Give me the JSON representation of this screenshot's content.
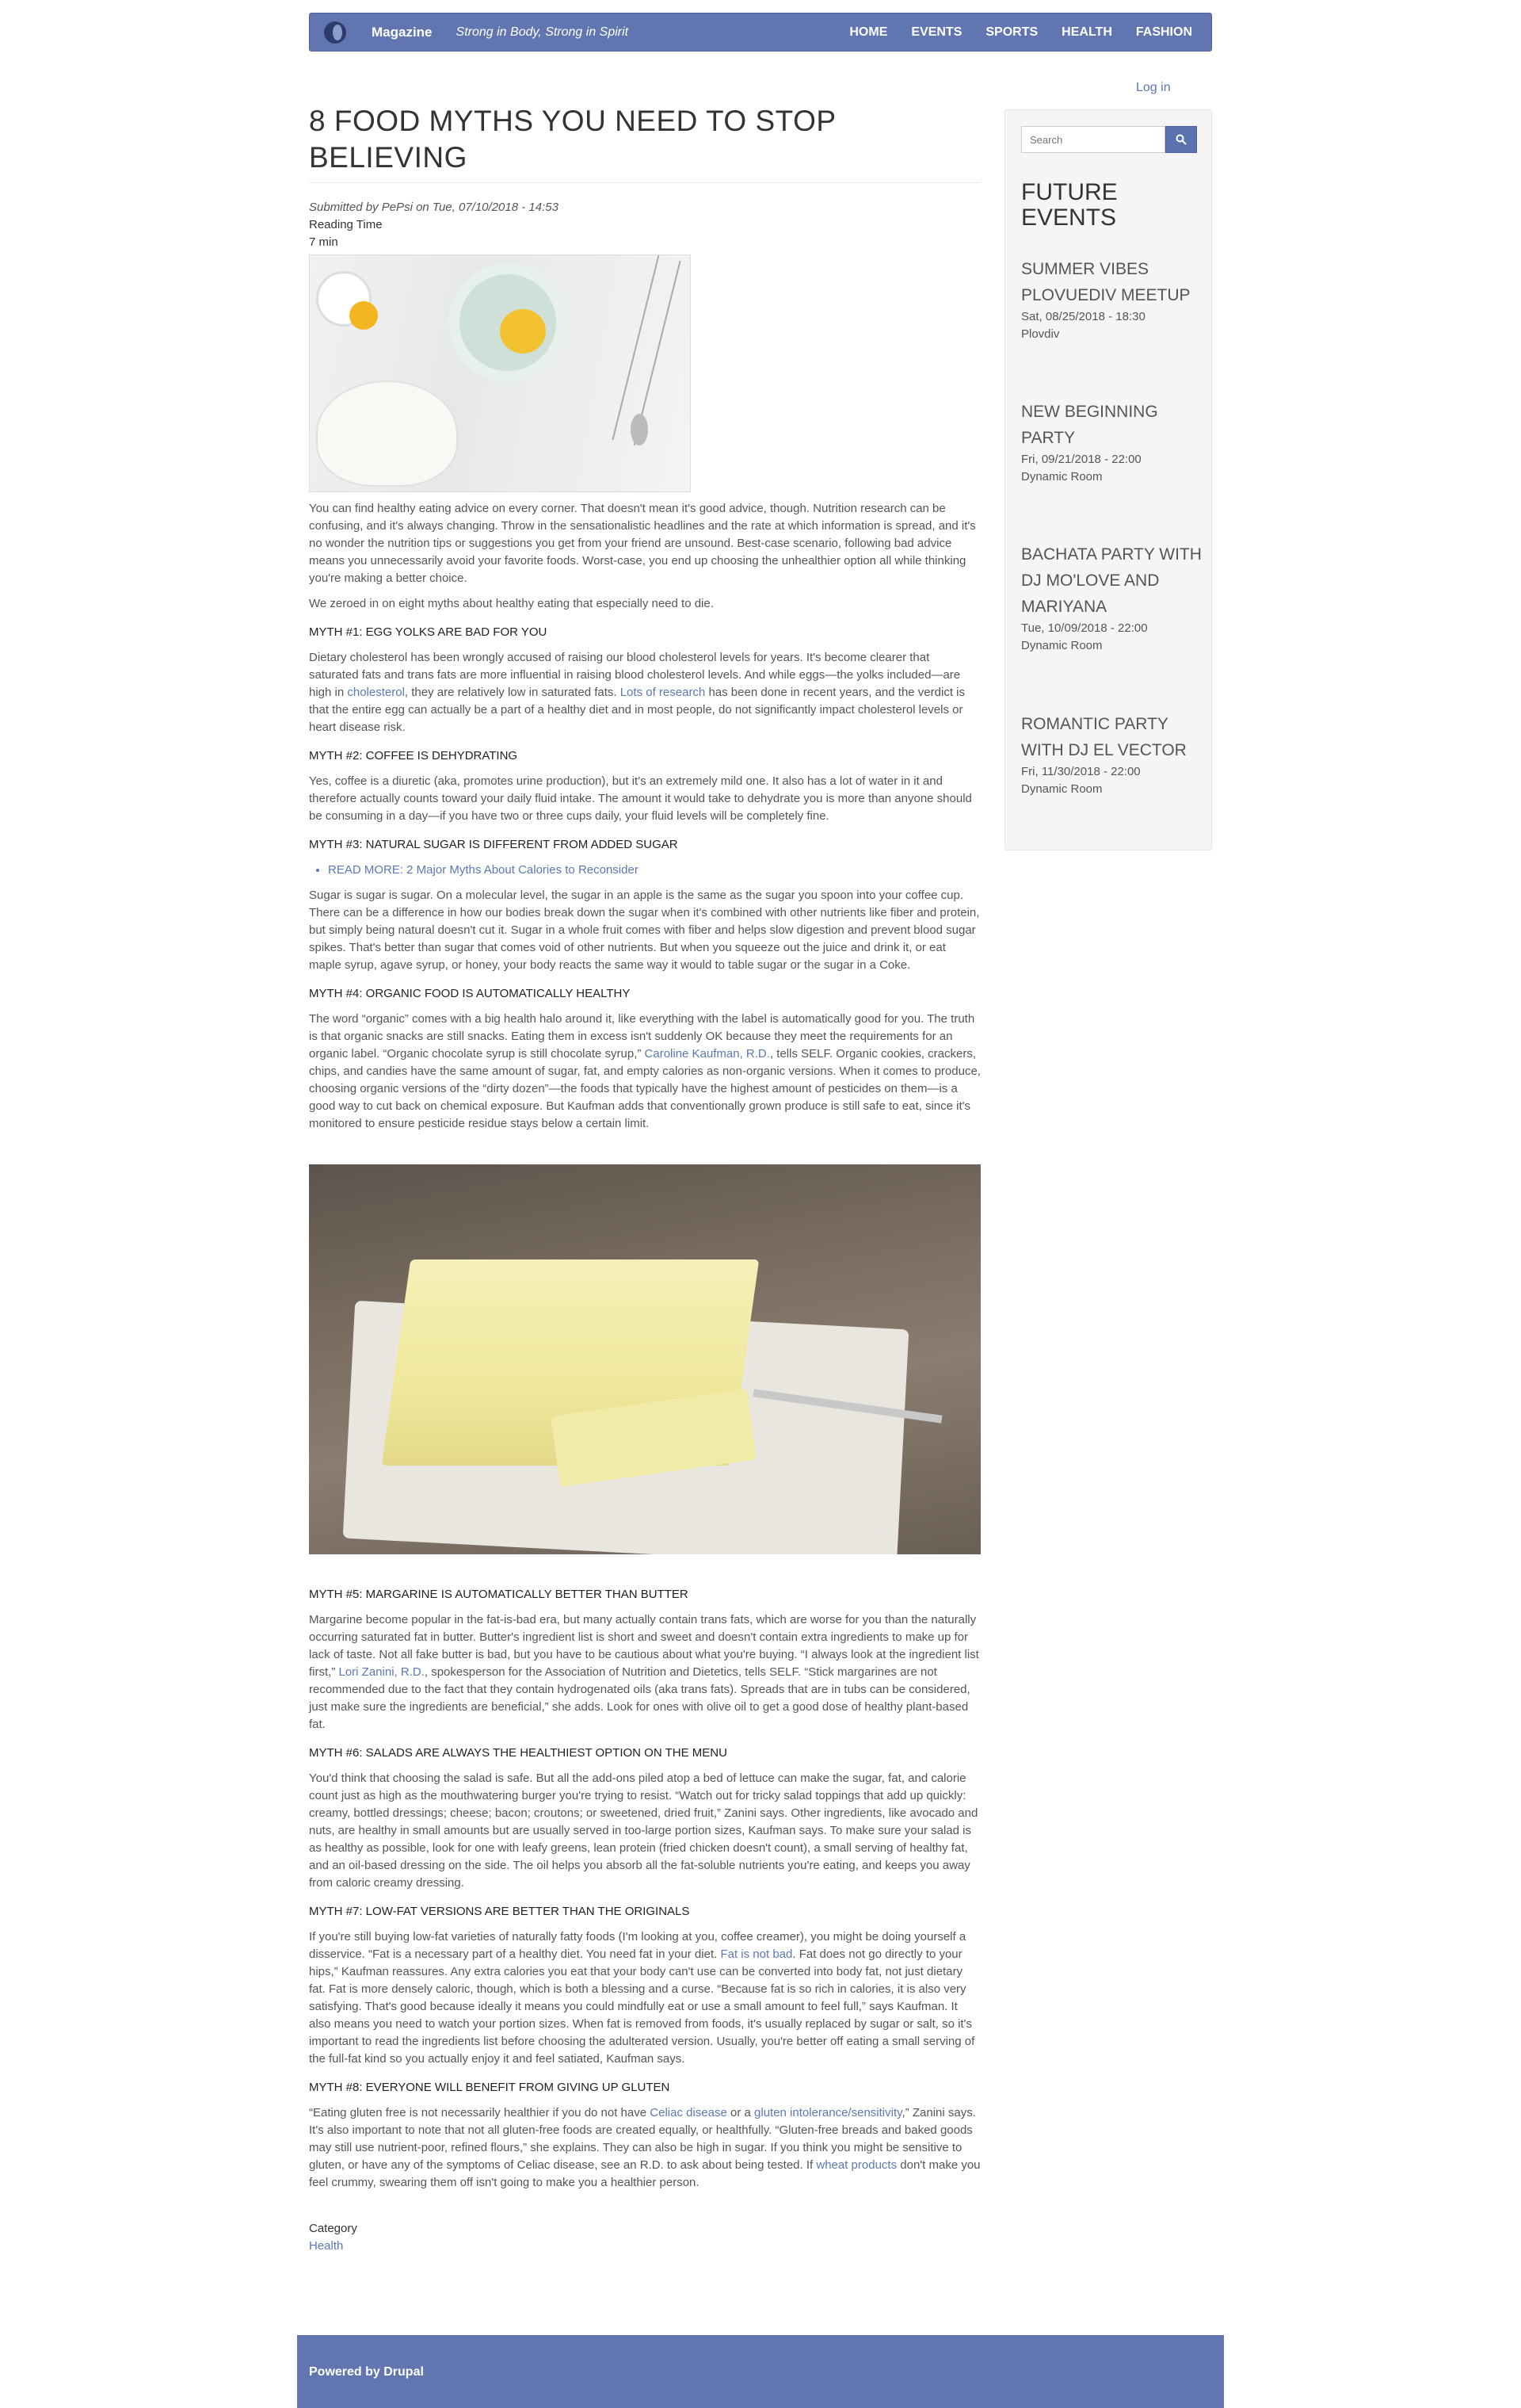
{
  "header": {
    "site_name": "Magazine",
    "slogan": "Strong in Body, Strong in Spirit",
    "menu": [
      "HOME",
      "EVENTS",
      "SPORTS",
      "HEALTH",
      "FASHION"
    ]
  },
  "user": {
    "login": "Log in"
  },
  "article": {
    "title": "8 FOOD MYTHS YOU NEED TO STOP BELIEVING",
    "submitted": "Submitted by PePsi on Tue, 07/10/2018 - 14:53",
    "reading_time_label": "Reading Time",
    "reading_time_value": "7 min",
    "intro": "You can find healthy eating advice on every corner. That doesn't mean it's good advice, though. Nutrition research can be confusing, and it's always changing. Throw in the sensationalistic headlines and the rate at which information is spread, and it's no wonder the nutrition tips or suggestions you get from your friend are unsound. Best-case scenario, following bad advice means you unnecessarily avoid your favorite foods. Worst-case, you end up choosing the unhealthier option all while thinking you're making a better choice.",
    "zeroed": "We zeroed in on eight myths about healthy eating that especially need to die.",
    "myth1_title": "MYTH #1: EGG YOLKS ARE BAD FOR YOU",
    "myth1_a": "Dietary cholesterol has been wrongly accused of raising our blood cholesterol levels for years. It's become clearer that saturated fats and trans fats are more influential in raising blood cholesterol levels. And while eggs—the yolks included—are high in ",
    "myth1_link1": "cholesterol",
    "myth1_b": ", they are relatively low in saturated fats. ",
    "myth1_link2": "Lots of research",
    "myth1_c": " has been done in recent years, and the verdict is that the entire egg can actually be a part of a healthy diet and in most people, do not significantly impact cholesterol levels or heart disease risk.",
    "myth2_title": "MYTH #2: COFFEE IS DEHYDRATING",
    "myth2": "Yes, coffee is a diuretic (aka, promotes urine production), but it's an extremely mild one. It also has a lot of water in it and therefore actually counts toward your daily fluid intake. The amount it would take to dehydrate you is more than anyone should be consuming in a day—if you have two or three cups daily, your fluid levels will be completely fine.",
    "myth3_title": "MYTH #3: NATURAL SUGAR IS DIFFERENT FROM ADDED SUGAR",
    "read_more": "READ MORE: 2 Major Myths About Calories to Reconsider",
    "myth3": "Sugar is sugar is sugar. On a molecular level, the sugar in an apple is the same as the sugar you spoon into your coffee cup. There can be a difference in how our bodies break down the sugar when it's combined with other nutrients like fiber and protein, but simply being natural doesn't cut it. Sugar in a whole fruit comes with fiber and helps slow digestion and prevent blood sugar spikes. That's better than sugar that comes void of other nutrients. But when you squeeze out the juice and drink it, or eat maple syrup, agave syrup, or honey, your body reacts the same way it would to table sugar or the sugar in a Coke.",
    "myth4_title": "MYTH #4: ORGANIC FOOD IS AUTOMATICALLY HEALTHY",
    "myth4_a": "The word “organic” comes with a big health halo around it, like everything with the label is automatically good for you. The truth is that organic snacks are still snacks. Eating them in excess isn't suddenly OK because they meet the requirements for an organic label. “Organic chocolate syrup is still chocolate syrup,” ",
    "myth4_link": "Caroline Kaufman, R.D.",
    "myth4_b": ", tells SELF. Organic cookies, crackers, chips, and candies have the same amount of sugar, fat, and empty calories as non-organic versions. When it comes to produce, choosing organic versions of the “dirty dozen”—the foods that typically have the highest amount of pesticides on them—is a good way to cut back on chemical exposure. But Kaufman adds that conventionally grown produce is still safe to eat, since it's monitored to ensure pesticide residue stays below a certain limit.",
    "myth5_title": "MYTH #5: MARGARINE IS AUTOMATICALLY BETTER THAN BUTTER",
    "myth5_a": "Margarine become popular in the fat-is-bad era, but many actually contain trans fats, which are worse for you than the naturally occurring saturated fat in butter. Butter's ingredient list is short and sweet and doesn't contain extra ingredients to make up for lack of taste. Not all fake butter is bad, but you have to be cautious about what you're buying. “I always look at the ingredient list first,” ",
    "myth5_link": "Lori Zanini, R.D.",
    "myth5_b": ", spokesperson for the Association of Nutrition and Dietetics, tells SELF. “Stick margarines are not recommended due to the fact that they contain hydrogenated oils (aka trans fats). Spreads that are in tubs can be considered, just make sure the ingredients are beneficial,” she adds. Look for ones with olive oil to get a good dose of healthy plant-based fat.",
    "myth6_title": "MYTH #6: SALADS ARE ALWAYS THE HEALTHIEST OPTION ON THE MENU",
    "myth6": "You'd think that choosing the salad is safe. But all the add-ons piled atop a bed of lettuce can make the sugar, fat, and calorie count just as high as the mouthwatering burger you're trying to resist. “Watch out for tricky salad toppings that add up quickly: creamy, bottled dressings; cheese; bacon; croutons; or sweetened, dried fruit,” Zanini says. Other ingredients, like avocado and nuts, are healthy in small amounts but are usually served in too-large portion sizes, Kaufman says. To make sure your salad is as healthy as possible, look for one with leafy greens, lean protein (fried chicken doesn't count), a small serving of healthy fat, and an oil-based dressing on the side. The oil helps you absorb all the fat-soluble nutrients you're eating, and keeps you away from caloric creamy dressing.",
    "myth7_title": "MYTH #7: LOW-FAT VERSIONS ARE BETTER THAN THE ORIGINALS",
    "myth7_a": "If you're still buying low-fat varieties of naturally fatty foods (I'm looking at you, coffee creamer), you might be doing yourself a disservice. “Fat is a necessary part of a healthy diet. You need fat in your diet. ",
    "myth7_link": "Fat is not bad",
    "myth7_b": ". Fat does not go directly to your hips,” Kaufman reassures. Any extra calories you eat that your body can't use can be converted into body fat, not just dietary fat. Fat is more densely caloric, though, which is both a blessing and a curse. “Because fat is so rich in calories, it is also very satisfying. That's good because ideally it means you could mindfully eat or use a small amount to feel full,” says Kaufman. It also means you need to watch your portion sizes. When fat is removed from foods, it's usually replaced by sugar or salt, so it's important to read the ingredients list before choosing the adulterated version. Usually, you're better off eating a small serving of the full-fat kind so you actually enjoy it and feel satiated, Kaufman says.",
    "myth8_title": "MYTH #8: EVERYONE WILL BENEFIT FROM GIVING UP GLUTEN",
    "myth8_a": "“Eating gluten free is not necessarily healthier if you do not have ",
    "myth8_link1": "Celiac disease",
    "myth8_b": " or a ",
    "myth8_link2": "gluten intolerance/sensitivity",
    "myth8_c": ",” Zanini says. It's also important to note that not all gluten-free foods are created equally, or healthfully. “Gluten-free breads and baked goods may still use nutrient-poor, refined flours,” she explains. They can also be high in sugar. If you think you might be sensitive to gluten, or have any of the symptoms of Celiac disease, see an R.D. to ask about being tested. If ",
    "myth8_link3": "wheat products",
    "myth8_d": " don't make you feel crummy, swearing them off isn't going to make you a healthier person.",
    "category_label": "Category",
    "category_value": "Health"
  },
  "sidebar": {
    "search_placeholder": "Search",
    "title": "FUTURE EVENTS",
    "events": [
      {
        "title": "SUMMER VIBES PLOVUEDIV MEETUP",
        "date": "Sat, 08/25/2018 - 18:30",
        "location": "Plovdiv"
      },
      {
        "title": "NEW BEGINNING PARTY",
        "date": "Fri, 09/21/2018 - 22:00",
        "location": "Dynamic Room"
      },
      {
        "title": "BACHATA PARTY WITH DJ MO'LOVE AND MARIYANA",
        "date": "Tue, 10/09/2018 - 22:00",
        "location": "Dynamic Room"
      },
      {
        "title": "ROMANTIC PARTY WITH DJ EL VECTOR",
        "date": "Fri, 11/30/2018 - 22:00",
        "location": "Dynamic Room"
      }
    ]
  },
  "footer": {
    "text": "Powered by Drupal"
  }
}
